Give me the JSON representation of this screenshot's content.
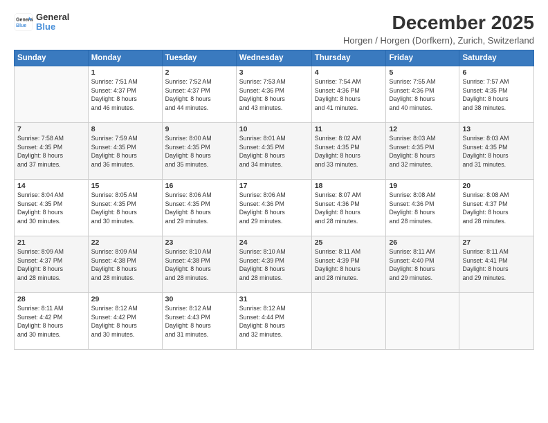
{
  "logo": {
    "general": "General",
    "blue": "Blue"
  },
  "title": "December 2025",
  "subtitle": "Horgen / Horgen (Dorfkern), Zurich, Switzerland",
  "days_header": [
    "Sunday",
    "Monday",
    "Tuesday",
    "Wednesday",
    "Thursday",
    "Friday",
    "Saturday"
  ],
  "weeks": [
    [
      {
        "day": "",
        "info": ""
      },
      {
        "day": "1",
        "info": "Sunrise: 7:51 AM\nSunset: 4:37 PM\nDaylight: 8 hours\nand 46 minutes."
      },
      {
        "day": "2",
        "info": "Sunrise: 7:52 AM\nSunset: 4:37 PM\nDaylight: 8 hours\nand 44 minutes."
      },
      {
        "day": "3",
        "info": "Sunrise: 7:53 AM\nSunset: 4:36 PM\nDaylight: 8 hours\nand 43 minutes."
      },
      {
        "day": "4",
        "info": "Sunrise: 7:54 AM\nSunset: 4:36 PM\nDaylight: 8 hours\nand 41 minutes."
      },
      {
        "day": "5",
        "info": "Sunrise: 7:55 AM\nSunset: 4:36 PM\nDaylight: 8 hours\nand 40 minutes."
      },
      {
        "day": "6",
        "info": "Sunrise: 7:57 AM\nSunset: 4:35 PM\nDaylight: 8 hours\nand 38 minutes."
      }
    ],
    [
      {
        "day": "7",
        "info": "Sunrise: 7:58 AM\nSunset: 4:35 PM\nDaylight: 8 hours\nand 37 minutes."
      },
      {
        "day": "8",
        "info": "Sunrise: 7:59 AM\nSunset: 4:35 PM\nDaylight: 8 hours\nand 36 minutes."
      },
      {
        "day": "9",
        "info": "Sunrise: 8:00 AM\nSunset: 4:35 PM\nDaylight: 8 hours\nand 35 minutes."
      },
      {
        "day": "10",
        "info": "Sunrise: 8:01 AM\nSunset: 4:35 PM\nDaylight: 8 hours\nand 34 minutes."
      },
      {
        "day": "11",
        "info": "Sunrise: 8:02 AM\nSunset: 4:35 PM\nDaylight: 8 hours\nand 33 minutes."
      },
      {
        "day": "12",
        "info": "Sunrise: 8:03 AM\nSunset: 4:35 PM\nDaylight: 8 hours\nand 32 minutes."
      },
      {
        "day": "13",
        "info": "Sunrise: 8:03 AM\nSunset: 4:35 PM\nDaylight: 8 hours\nand 31 minutes."
      }
    ],
    [
      {
        "day": "14",
        "info": "Sunrise: 8:04 AM\nSunset: 4:35 PM\nDaylight: 8 hours\nand 30 minutes."
      },
      {
        "day": "15",
        "info": "Sunrise: 8:05 AM\nSunset: 4:35 PM\nDaylight: 8 hours\nand 30 minutes."
      },
      {
        "day": "16",
        "info": "Sunrise: 8:06 AM\nSunset: 4:35 PM\nDaylight: 8 hours\nand 29 minutes."
      },
      {
        "day": "17",
        "info": "Sunrise: 8:06 AM\nSunset: 4:36 PM\nDaylight: 8 hours\nand 29 minutes."
      },
      {
        "day": "18",
        "info": "Sunrise: 8:07 AM\nSunset: 4:36 PM\nDaylight: 8 hours\nand 28 minutes."
      },
      {
        "day": "19",
        "info": "Sunrise: 8:08 AM\nSunset: 4:36 PM\nDaylight: 8 hours\nand 28 minutes."
      },
      {
        "day": "20",
        "info": "Sunrise: 8:08 AM\nSunset: 4:37 PM\nDaylight: 8 hours\nand 28 minutes."
      }
    ],
    [
      {
        "day": "21",
        "info": "Sunrise: 8:09 AM\nSunset: 4:37 PM\nDaylight: 8 hours\nand 28 minutes."
      },
      {
        "day": "22",
        "info": "Sunrise: 8:09 AM\nSunset: 4:38 PM\nDaylight: 8 hours\nand 28 minutes."
      },
      {
        "day": "23",
        "info": "Sunrise: 8:10 AM\nSunset: 4:38 PM\nDaylight: 8 hours\nand 28 minutes."
      },
      {
        "day": "24",
        "info": "Sunrise: 8:10 AM\nSunset: 4:39 PM\nDaylight: 8 hours\nand 28 minutes."
      },
      {
        "day": "25",
        "info": "Sunrise: 8:11 AM\nSunset: 4:39 PM\nDaylight: 8 hours\nand 28 minutes."
      },
      {
        "day": "26",
        "info": "Sunrise: 8:11 AM\nSunset: 4:40 PM\nDaylight: 8 hours\nand 29 minutes."
      },
      {
        "day": "27",
        "info": "Sunrise: 8:11 AM\nSunset: 4:41 PM\nDaylight: 8 hours\nand 29 minutes."
      }
    ],
    [
      {
        "day": "28",
        "info": "Sunrise: 8:11 AM\nSunset: 4:42 PM\nDaylight: 8 hours\nand 30 minutes."
      },
      {
        "day": "29",
        "info": "Sunrise: 8:12 AM\nSunset: 4:42 PM\nDaylight: 8 hours\nand 30 minutes."
      },
      {
        "day": "30",
        "info": "Sunrise: 8:12 AM\nSunset: 4:43 PM\nDaylight: 8 hours\nand 31 minutes."
      },
      {
        "day": "31",
        "info": "Sunrise: 8:12 AM\nSunset: 4:44 PM\nDaylight: 8 hours\nand 32 minutes."
      },
      {
        "day": "",
        "info": ""
      },
      {
        "day": "",
        "info": ""
      },
      {
        "day": "",
        "info": ""
      }
    ]
  ]
}
